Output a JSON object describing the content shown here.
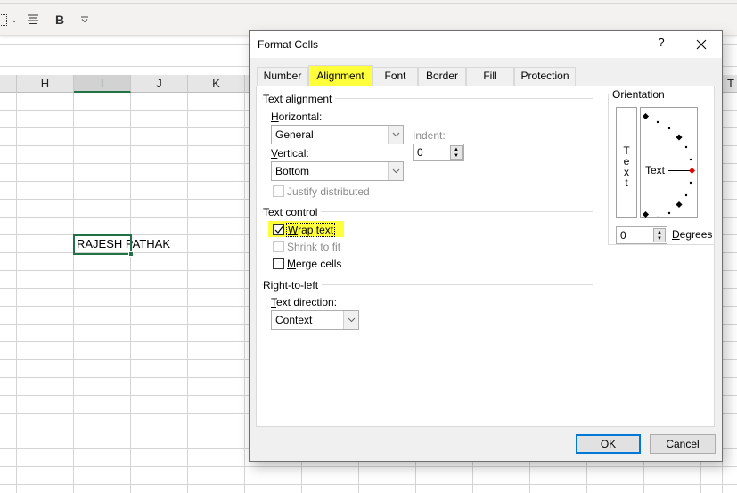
{
  "ribbon": {
    "bold_label": "B",
    "icons": [
      "borders-icon",
      "chevron-down-icon",
      "align-center-icon",
      "bold-icon",
      "more-options-icon"
    ]
  },
  "sheet": {
    "columns": [
      {
        "label": "H",
        "selected": false
      },
      {
        "label": "I",
        "selected": true
      },
      {
        "label": "J",
        "selected": false
      },
      {
        "label": "K",
        "selected": false
      },
      {
        "label": "T",
        "selected": false
      }
    ],
    "active_cell": "I",
    "active_cell_value": "RAJESH PATHAK",
    "accent_color": "#217346"
  },
  "dialog": {
    "title": "Format Cells",
    "help_label": "?",
    "close_label": "✕",
    "tabs": [
      {
        "label": "Number",
        "active": false
      },
      {
        "label": "Alignment",
        "active": true
      },
      {
        "label": "Font",
        "active": false
      },
      {
        "label": "Border",
        "active": false
      },
      {
        "label": "Fill",
        "active": false
      },
      {
        "label": "Protection",
        "active": false
      }
    ],
    "text_alignment": {
      "group_label": "Text alignment",
      "horizontal_label_u": "H",
      "horizontal_label_rest": "orizontal:",
      "horizontal_value": "General",
      "vertical_label_u": "V",
      "vertical_label_rest": "ertical:",
      "vertical_value": "Bottom",
      "indent_label": "Indent:",
      "indent_value": "0",
      "justify_distributed_label": "Justify distributed",
      "justify_distributed_checked": false,
      "justify_distributed_enabled": false
    },
    "text_control": {
      "group_label": "Text control",
      "wrap_text_label_u": "W",
      "wrap_text_label_rest": "rap text",
      "wrap_text_checked": true,
      "shrink_to_fit_label": "Shrink to fit",
      "shrink_to_fit_checked": false,
      "shrink_to_fit_enabled": false,
      "merge_cells_label_u": "M",
      "merge_cells_label_rest": "erge cells",
      "merge_cells_checked": false
    },
    "right_to_left": {
      "group_label": "Right-to-left",
      "text_direction_label_u": "T",
      "text_direction_label_rest": "ext direction:",
      "text_direction_value": "Context"
    },
    "orientation": {
      "group_label": "Orientation",
      "vertical_text": [
        "T",
        "e",
        "x",
        "t"
      ],
      "dial_text": "Text",
      "degrees_value": "0",
      "degrees_label_u": "D",
      "degrees_label_rest": "egrees"
    },
    "ok_label": "OK",
    "cancel_label": "Cancel",
    "highlight_color": "#ffff3a"
  }
}
